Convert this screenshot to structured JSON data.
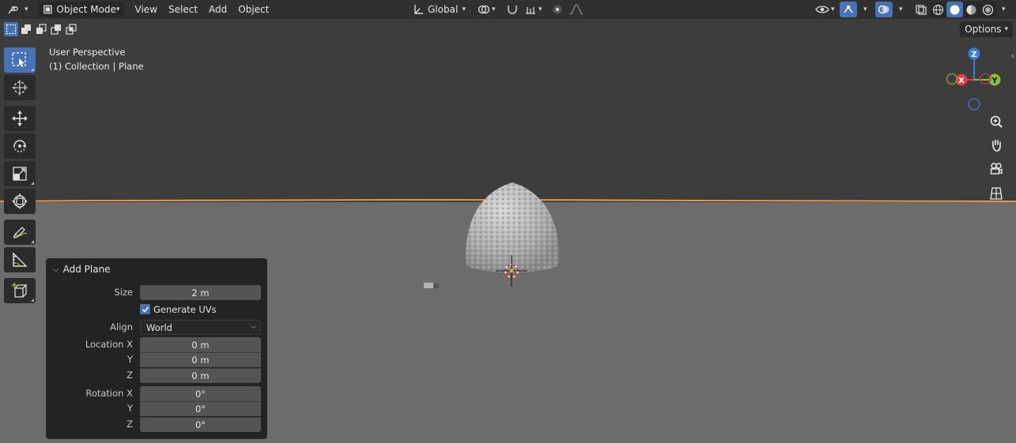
{
  "header": {
    "mode": "Object Mode",
    "menus": [
      "View",
      "Select",
      "Add",
      "Object"
    ],
    "orientation": "Global"
  },
  "overlay": {
    "view_name": "User Perspective",
    "collection_info": "(1) Collection | Plane",
    "options_label": "Options"
  },
  "gizmo": {
    "z_label": "Z",
    "x_label": "X",
    "y_label": "Y",
    "colors": {
      "x": "#e8384f",
      "y": "#8cbf35",
      "z": "#3b7ed8"
    }
  },
  "panel": {
    "title": "Add Plane",
    "size_label": "Size",
    "size_value": "2 m",
    "generate_uvs_label": "Generate UVs",
    "generate_uvs_checked": true,
    "align_label": "Align",
    "align_value": "World",
    "location_label": "Location X",
    "location_y_label": "Y",
    "location_z_label": "Z",
    "location_x": "0 m",
    "location_y": "0 m",
    "location_z": "0 m",
    "rotation_label": "Rotation X",
    "rotation_y_label": "Y",
    "rotation_z_label": "Z",
    "rotation_x": "0°",
    "rotation_y": "0°",
    "rotation_z": "0°"
  },
  "colors": {
    "accent": "#4772b3",
    "selection_outline": "#f2a14a",
    "header_bg": "#303030",
    "viewport_bg": "#3d3d3d",
    "floor": "#6c6c6c"
  },
  "tools": [
    "select-box",
    "cursor",
    "move",
    "rotate",
    "scale",
    "transform",
    "annotate",
    "measure",
    "add-cube"
  ]
}
